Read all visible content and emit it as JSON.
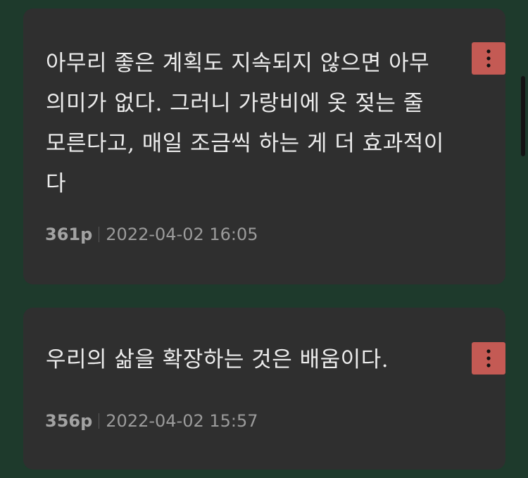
{
  "notes": [
    {
      "text": "아무리 좋은 계획도 지속되지 않으면 아무 의미가 없다. 그러니 가랑비에 옷 젖는 줄 모른다고, 매일 조금씩 하는 게 더 효과적이다",
      "page": "361p",
      "date": "2022-04-02 16:05",
      "menu_icon": "vertical-dots-icon"
    },
    {
      "text": "우리의 삶을 확장하는 것은 배움이다.",
      "page": "356p",
      "date": "2022-04-02 15:57",
      "menu_icon": "vertical-dots-icon"
    }
  ],
  "colors": {
    "background": "#1e3a2c",
    "card": "#2f2f2f",
    "menu_button": "#c45a54",
    "quote_text": "#ececec",
    "meta_text": "#9b9b9b"
  }
}
